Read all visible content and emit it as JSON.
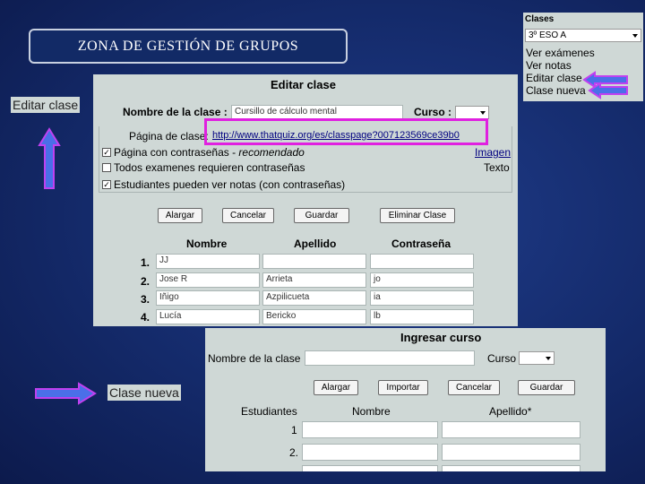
{
  "slide_title": "ZONA DE GESTIÓN DE GRUPOS",
  "menu": {
    "label": "Clases",
    "selected_class": "3º ESO A",
    "items": [
      "Ver exámenes",
      "Ver notas",
      "Editar clase",
      "Clase nueva"
    ]
  },
  "side_labels": {
    "edit": "Editar clase",
    "new": "Clase nueva"
  },
  "edit_form": {
    "title": "Editar clase",
    "class_name_label": "Nombre de la clase :",
    "class_name_value": "Cursillo de cálculo mental",
    "course_label": "Curso :",
    "page_label": "Página de clase:",
    "page_url": "http://www.thatquiz.org/es/classpage?007123569ce39b0",
    "options": [
      {
        "checked": true,
        "text": "Página con contraseñas - ",
        "em": "recomendado",
        "right": "Imagen"
      },
      {
        "checked": false,
        "text": "Todos examenes requieren contraseñas",
        "em": "",
        "right": "Texto"
      },
      {
        "checked": true,
        "text": "Estudiantes pueden ver notas (con contraseñas)",
        "em": "",
        "right": ""
      }
    ],
    "buttons": [
      "Alargar",
      "Cancelar",
      "Guardar",
      "Eliminar Clase"
    ],
    "columns": [
      "Nombre",
      "Apellido",
      "Contraseña"
    ],
    "rows": [
      {
        "num": "1.",
        "nombre": "JJ",
        "apellido": "",
        "pass": ""
      },
      {
        "num": "2.",
        "nombre": "Jose R",
        "apellido": "Arrieta",
        "pass": "jo"
      },
      {
        "num": "3.",
        "nombre": "Iñigo",
        "apellido": "Azpilicueta",
        "pass": "ia"
      },
      {
        "num": "4.",
        "nombre": "Lucía",
        "apellido": "Bericko",
        "pass": "lb"
      }
    ]
  },
  "new_form": {
    "title": "Ingresar curso",
    "class_name_label": "Nombre de la clase",
    "course_label": "Curso",
    "buttons": [
      "Alargar",
      "Importar",
      "Cancelar",
      "Guardar"
    ],
    "columns": [
      "Estudiantes",
      "Nombre",
      "Apellido*"
    ],
    "rows": [
      "1",
      "2."
    ]
  },
  "colors": {
    "highlight": "#e020e0",
    "arrow_fill": "#4a6fe8",
    "arrow_border": "#c040f0"
  }
}
